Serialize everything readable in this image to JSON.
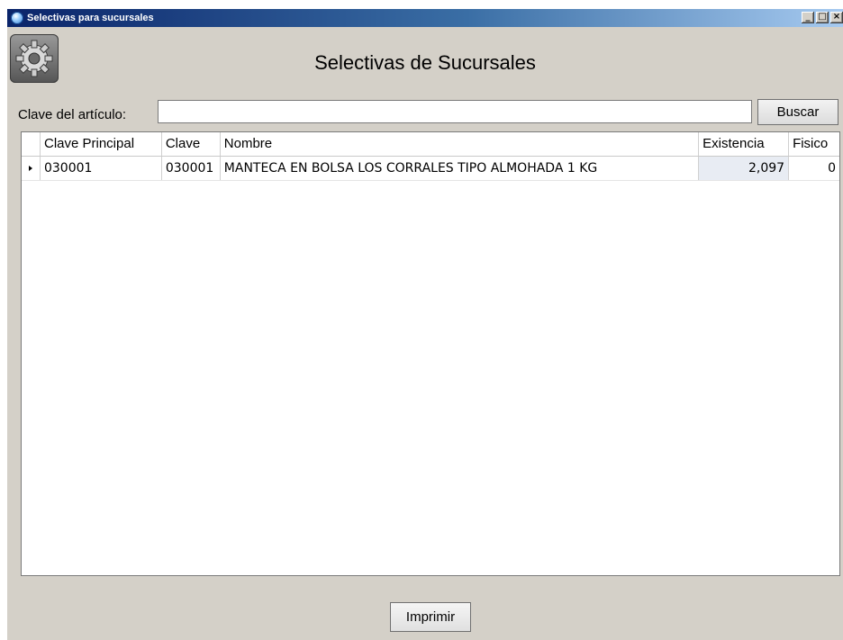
{
  "window": {
    "title": "Selectivas para sucursales",
    "minimize": "_",
    "maximize": "□",
    "close": "×"
  },
  "header": {
    "title": "Selectivas de Sucursales",
    "icon": "gear-icon"
  },
  "search": {
    "label": "Clave del artículo:",
    "value": "",
    "placeholder": "",
    "button_label": "Buscar"
  },
  "grid": {
    "columns": [
      "Clave Principal",
      "Clave",
      "Nombre",
      "Existencia",
      "Fisico"
    ],
    "rows": [
      {
        "clave_principal": "030001",
        "clave": "030001",
        "nombre": "MANTECA EN BOLSA LOS CORRALES TIPO ALMOHADA 1 KG",
        "existencia": "2,097",
        "fisico": "0"
      }
    ]
  },
  "footer": {
    "print_label": "Imprimir"
  }
}
